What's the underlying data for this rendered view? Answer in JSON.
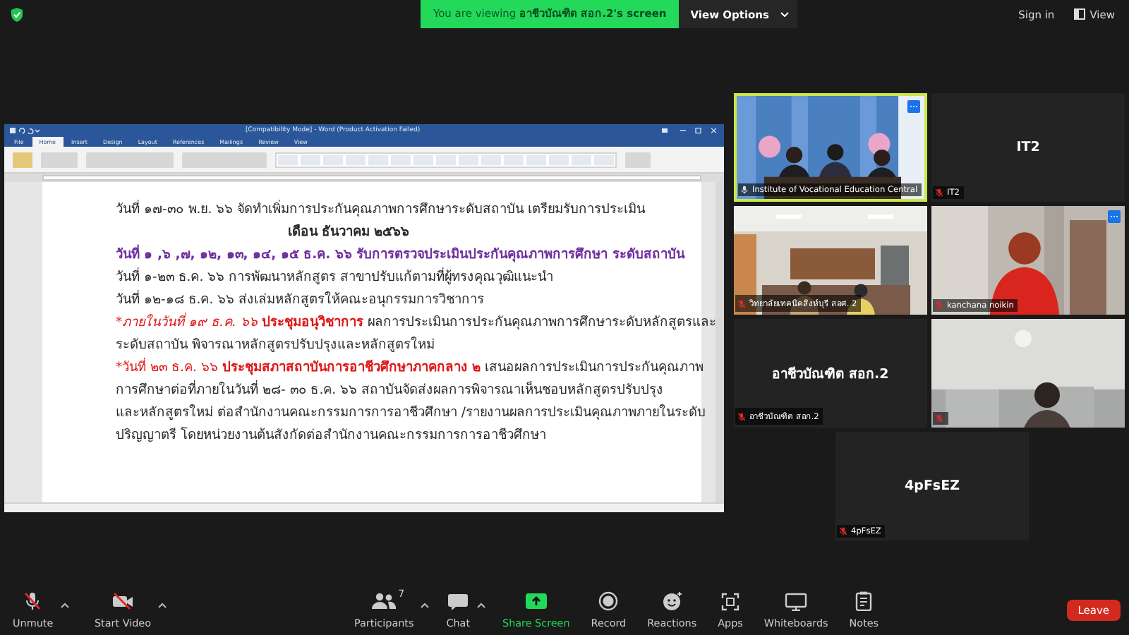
{
  "top_bar": {
    "banner": "You are viewing **อาชีวบัณฑิต สอก.2's screen**",
    "view_options": "View Options",
    "sign_in": "Sign in",
    "view": "View"
  },
  "shared_document": {
    "window_title": "[Compatibility Mode] - Word (Product Activation Failed)",
    "ribbon_tabs": [
      {
        "label": "File",
        "selected": false
      },
      {
        "label": "Home",
        "selected": true
      },
      {
        "label": "Insert",
        "selected": false
      },
      {
        "label": "Design",
        "selected": false
      },
      {
        "label": "Layout",
        "selected": false
      },
      {
        "label": "References",
        "selected": false
      },
      {
        "label": "Mailings",
        "selected": false
      },
      {
        "label": "Review",
        "selected": false
      },
      {
        "label": "View",
        "selected": false
      }
    ],
    "lines": [
      {
        "kind": "body",
        "runs": [
          {
            "kind": "plain",
            "text": "วันที่ ๑๗-๓๐ พ.ย. ๖๖ จัดทำเพิ่มการประกันคุณภาพการศึกษาระดับสถาบัน เตรียมรับการประเมิน"
          }
        ]
      },
      {
        "kind": "heading",
        "runs": [
          {
            "kind": "bold",
            "text": "เดือน ธันวาคม ๒๕๖๖"
          }
        ]
      },
      {
        "kind": "body",
        "runs": [
          {
            "kind": "highlight",
            "text": "วันที่ ๑ ,๖ ,๗, ๑๒, ๑๓, ๑๔, ๑๕ ธ.ค. ๖๖ รับการตรวจประเมินประกันคุณภาพการศึกษา ระดับสถาบัน"
          }
        ]
      },
      {
        "kind": "body",
        "runs": [
          {
            "kind": "plain",
            "text": "วันที่ ๑-๒๓ ธ.ค. ๖๖ การพัฒนาหลักสูตร สาขาปรับแก้ตามที่ผู้ทรงคุณวุฒิแนะนำ"
          }
        ]
      },
      {
        "kind": "body",
        "runs": [
          {
            "kind": "plain",
            "text": "วันที่ ๑๒-๑๘ ธ.ค. ๖๖ ส่งเล่มหลักสูตรให้คณะอนุกรรมการวิชาการ"
          }
        ]
      },
      {
        "kind": "body",
        "runs": [
          {
            "kind": "note",
            "text": "*ภายในวันที่ ๑๙ ธ.ค. ๖๖ "
          },
          {
            "kind": "alert",
            "text": "ประชุมอนุวิชาการ"
          },
          {
            "kind": "plain",
            "text": " ผลการประเมินการประกันคุณภาพการศึกษาระดับหลักสูตรและ"
          }
        ]
      },
      {
        "kind": "body",
        "runs": [
          {
            "kind": "plain",
            "text": "ระดับสถาบัน พิจารณาหลักสูตรปรับปรุงและหลักสูตรใหม่"
          }
        ]
      },
      {
        "kind": "body",
        "runs": [
          {
            "kind": "red",
            "text": "*วันที่ ๒๓ ธ.ค. ๖๖ "
          },
          {
            "kind": "alert",
            "text": "ประชุมสภาสถาบันการอาชีวศึกษาภาคกลาง ๒"
          },
          {
            "kind": "plain",
            "text": " เสนอผลการประเมินการประกันคุณภาพ"
          }
        ]
      },
      {
        "kind": "body",
        "runs": [
          {
            "kind": "plain",
            "text": "การศึกษาต่อที่ภายในวันที่ ๒๘- ๓๐ ธ.ค. ๖๖ สถาบันจัดส่งผลการพิจารณาเห็นชอบหลักสูตรปรับปรุง"
          }
        ]
      },
      {
        "kind": "body",
        "runs": [
          {
            "kind": "plain",
            "text": "และหลักสูตรใหม่ ต่อสำนักงานคณะกรรมการการอาชีวศึกษา /รายงานผลการประเมินคุณภาพภายในระดับ"
          }
        ]
      },
      {
        "kind": "body",
        "runs": [
          {
            "kind": "plain",
            "text": "ปริญญาตรี โดยหน่วยงานต้นสังกัดต่อสำนักงานคณะกรรมการการอาชีวศึกษา"
          }
        ]
      }
    ]
  },
  "participants": [
    {
      "kind": "video",
      "name": "Institute of Vocational Education Central",
      "muted": false,
      "speaking": true,
      "menu": true
    },
    {
      "kind": "name",
      "display_name": "IT2",
      "name": "IT2",
      "muted": true,
      "speaking": false,
      "menu": false
    },
    {
      "kind": "video",
      "name": "วิทยาลัยเทคนิคสิงห์บุรี สอศ. 2",
      "muted": true,
      "speaking": false,
      "menu": false
    },
    {
      "kind": "video",
      "name": "kanchana noikin",
      "muted": true,
      "speaking": false,
      "menu": true
    },
    {
      "kind": "name",
      "display_name": "อาชีวบัณฑิต สอก.2",
      "name": "อาชีวบัณฑิต สอก.2",
      "muted": true,
      "speaking": false,
      "menu": false
    },
    {
      "kind": "video",
      "muted": true,
      "speaking": false,
      "menu": false
    },
    {
      "kind": "name",
      "display_name": "4pFsEZ",
      "name": "4pFsEZ",
      "muted": true,
      "speaking": false,
      "menu": false
    }
  ],
  "toolbar": {
    "left": [
      {
        "kind": "mic",
        "label": "Unmute",
        "off": true,
        "caret": true
      },
      {
        "kind": "camera",
        "label": "Start Video",
        "off": true,
        "caret": true
      }
    ],
    "center": [
      {
        "kind": "participants",
        "label": "Participants",
        "count": "7",
        "caret": true
      },
      {
        "kind": "chat",
        "label": "Chat",
        "caret": true
      },
      {
        "kind": "share",
        "label": "Share Screen",
        "caret": false
      },
      {
        "kind": "record",
        "label": "Record",
        "caret": false
      },
      {
        "kind": "reactions",
        "label": "Reactions",
        "caret": false
      },
      {
        "kind": "apps",
        "label": "Apps",
        "caret": false
      },
      {
        "kind": "whiteboards",
        "label": "Whiteboards",
        "caret": false
      },
      {
        "kind": "notes",
        "label": "Notes",
        "caret": false
      }
    ],
    "leave": "Leave"
  }
}
